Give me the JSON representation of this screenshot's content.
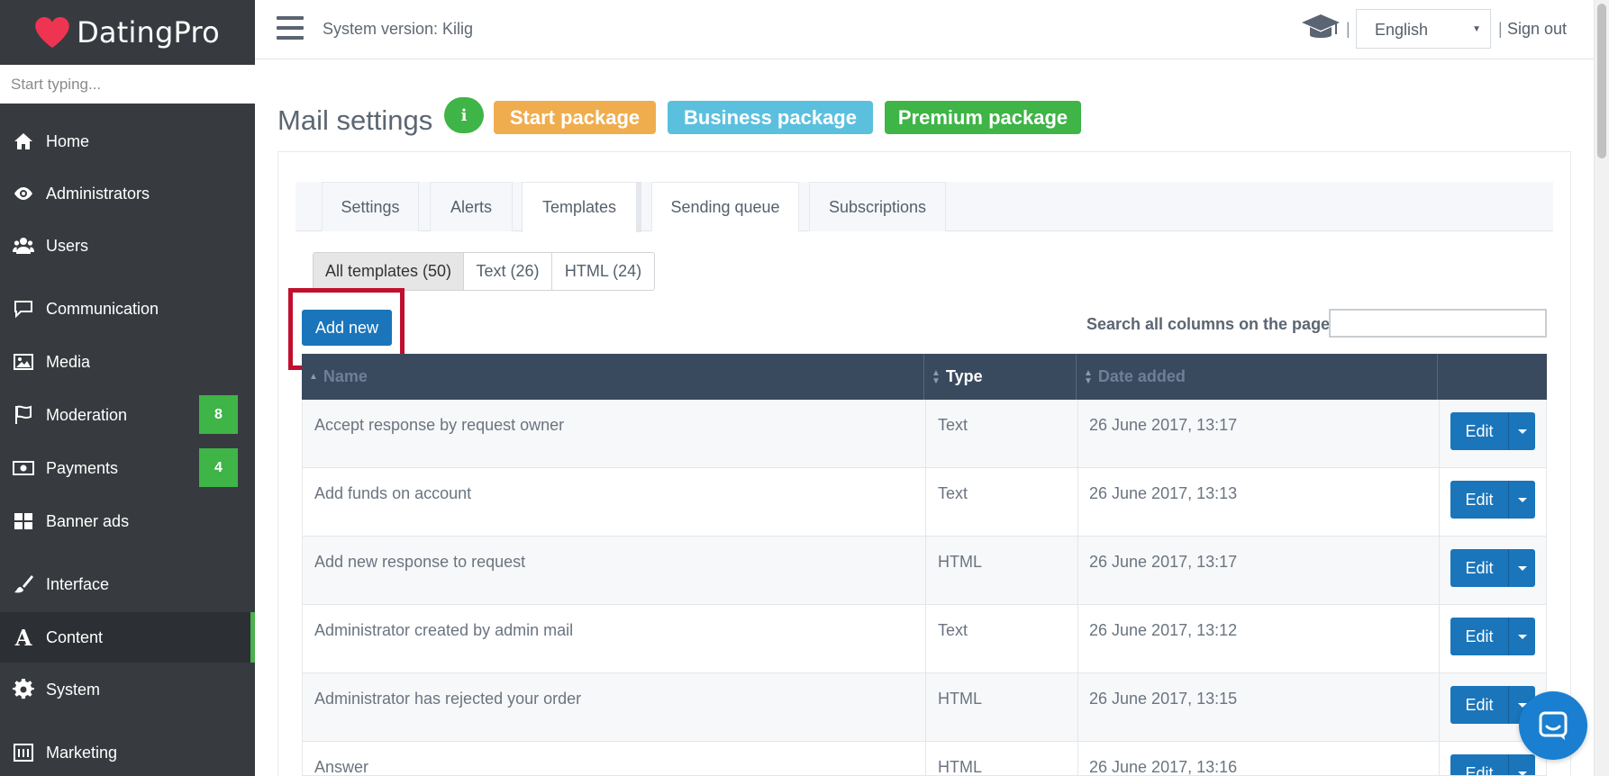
{
  "brand": {
    "name": "DatingPro",
    "heart_color": "#ef3451"
  },
  "sidebar": {
    "search_placeholder": "Start typing...",
    "items": [
      {
        "label": "Home",
        "icon": "home-icon"
      },
      {
        "label": "Administrators",
        "icon": "eye-icon"
      },
      {
        "label": "Users",
        "icon": "users-icon"
      },
      {
        "label": "Communication",
        "icon": "chat-icon"
      },
      {
        "label": "Media",
        "icon": "image-icon"
      },
      {
        "label": "Moderation",
        "icon": "flag-icon",
        "badge": "8"
      },
      {
        "label": "Payments",
        "icon": "money-icon",
        "badge": "4"
      },
      {
        "label": "Banner ads",
        "icon": "grid-icon"
      },
      {
        "label": "Interface",
        "icon": "brush-icon"
      },
      {
        "label": "Content",
        "icon": "font-icon",
        "active": true
      },
      {
        "label": "System",
        "icon": "gear-icon"
      },
      {
        "label": "Marketing",
        "icon": "marketing-icon"
      }
    ]
  },
  "topbar": {
    "system_version": "System version: Kilig",
    "language": "English",
    "sign_out": "Sign out",
    "separator": "|"
  },
  "page": {
    "title": "Mail settings",
    "info_label": "i",
    "packages": [
      {
        "label": "Start package",
        "color": "#f0ad4e"
      },
      {
        "label": "Business package",
        "color": "#5bc0de"
      },
      {
        "label": "Premium package",
        "color": "#3fb447"
      }
    ]
  },
  "tabs": [
    {
      "label": "Settings"
    },
    {
      "label": "Alerts"
    },
    {
      "label": "Templates",
      "active": true
    },
    {
      "label": "Sending queue"
    },
    {
      "label": "Subscriptions"
    }
  ],
  "filters": [
    {
      "label": "All templates (50)",
      "active": true
    },
    {
      "label": "Text (26)"
    },
    {
      "label": "HTML (24)"
    }
  ],
  "add_new_label": "Add new",
  "search_label": "Search all columns on the page:",
  "table": {
    "columns": [
      "Name",
      "Type",
      "Date added"
    ],
    "edit_label": "Edit",
    "rows": [
      {
        "name": "Accept response by request owner",
        "type": "Text",
        "date": "26 June 2017, 13:17"
      },
      {
        "name": "Add funds on account",
        "type": "Text",
        "date": "26 June 2017, 13:13"
      },
      {
        "name": "Add new response to request",
        "type": "HTML",
        "date": "26 June 2017, 13:17"
      },
      {
        "name": "Administrator created by admin mail",
        "type": "Text",
        "date": "26 June 2017, 13:12"
      },
      {
        "name": "Administrator has rejected your order",
        "type": "HTML",
        "date": "26 June 2017, 13:15"
      },
      {
        "name": "Answer",
        "type": "HTML",
        "date": "26 June 2017, 13:16"
      }
    ]
  },
  "colors": {
    "sidebar_bg": "#373b3f",
    "primary": "#1a75bb",
    "success": "#3fb447",
    "highlight": "#c0102e",
    "table_header": "#3a4a5e"
  }
}
